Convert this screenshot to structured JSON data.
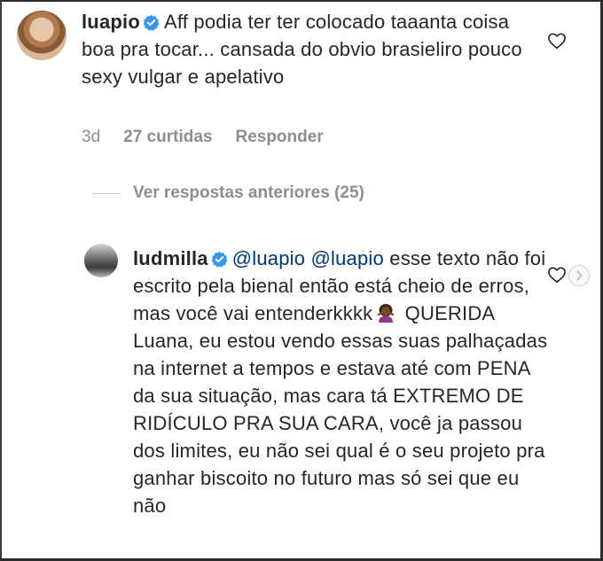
{
  "comment_1": {
    "username": "luapio",
    "text": "Aff podia ter ter colocado taaanta coisa boa pra tocar... cansada do obvio brasieliro pouco sexy vulgar e apelativo",
    "age": "3d",
    "likes": "27 curtidas",
    "reply_label": "Responder"
  },
  "view_replies": {
    "label": "Ver respostas anteriores (25)"
  },
  "comment_2": {
    "username": "ludmilla",
    "mentions": "@luapio @luapio",
    "text_before_emoji": " esse texto não foi escrito pela bienal então está cheio de erros, mas você vai entenderkkkk",
    "text_after_emoji": " QUERIDA Luana, eu estou vendo essas suas palhaçadas na internet a tempos e estava até com PENA da sua situação, mas cara tá EXTREMO DE RIDÍCULO PRA SUA CARA, você ja passou dos limites, eu não sei qual é o seu projeto pra ganhar biscoito no futuro mas só sei que eu não"
  },
  "icons": {
    "verified": "verified-badge-icon",
    "heart": "heart-outline-icon",
    "next": "chevron-right-icon",
    "emoji": "woman-gesturing-emoji"
  },
  "colors": {
    "verified": "#3897f0",
    "text": "#262626",
    "secondary": "#8e8e8e"
  }
}
